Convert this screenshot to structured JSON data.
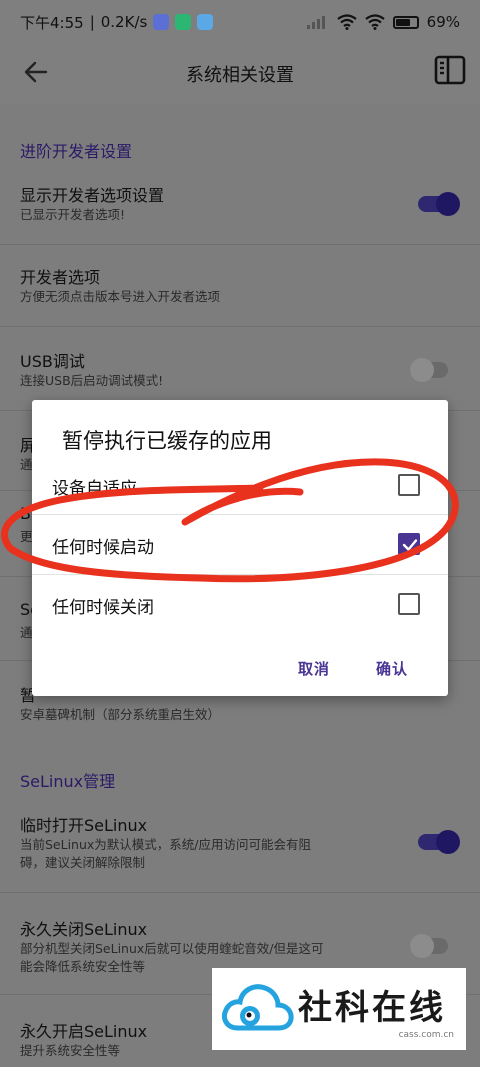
{
  "status_bar": {
    "time": "下午4:55",
    "speed": "0.2K/s",
    "battery": "69%",
    "battery_level": 0.69
  },
  "app_bar": {
    "title": "系统相关设置"
  },
  "sections": {
    "advanced_dev": "进阶开发者设置",
    "selinux": "SeLinux管理"
  },
  "rows": {
    "show_dev": {
      "title": "显示开发者选项设置",
      "subtitle": "已显示开发者选项!",
      "switch_on": true
    },
    "dev_options": {
      "title": "开发者选项",
      "subtitle": "方便无须点击版本号进入开发者选项"
    },
    "usb_debug": {
      "title": "USB调试",
      "subtitle": "连接USB后启动调试模式!",
      "switch_on": false
    },
    "partial_1": {
      "title": "屏",
      "subtitle": "通"
    },
    "partial_2": {
      "title": "B",
      "subtitle": "更"
    },
    "partial_3": {
      "title": "Se",
      "subtitle": "通"
    },
    "partial_4": {
      "title": "暂",
      "subtitle": "安卓墓碑机制（部分系统重启生效）"
    },
    "selinux_temp": {
      "title": "临时打开SeLinux",
      "subtitle_1": "当前SeLinux为默认模式，系统/应用访问可能会有阻",
      "subtitle_2": "碍，建议关闭解除限制",
      "switch_on": true
    },
    "selinux_off": {
      "title": "永久关闭SeLinux",
      "subtitle_1": "部分机型关闭SeLinux后就可以使用蝰蛇音效/但是这可",
      "subtitle_2": "能会降低系统安全性等",
      "switch_on": false
    },
    "selinux_on": {
      "title": "永久开启SeLinux",
      "subtitle": "提升系统安全性等"
    }
  },
  "dialog": {
    "title": "暂停执行已缓存的应用",
    "options": [
      {
        "label": "设备自适应",
        "checked": false
      },
      {
        "label": "任何时候启动",
        "checked": true
      },
      {
        "label": "任何时候关闭",
        "checked": false
      }
    ],
    "cancel": "取消",
    "confirm": "确认"
  },
  "watermark": {
    "name": "社科在线",
    "url": "cass.com.cn"
  },
  "colors": {
    "accent": "#4a3593",
    "annotation": "#e8321e"
  }
}
